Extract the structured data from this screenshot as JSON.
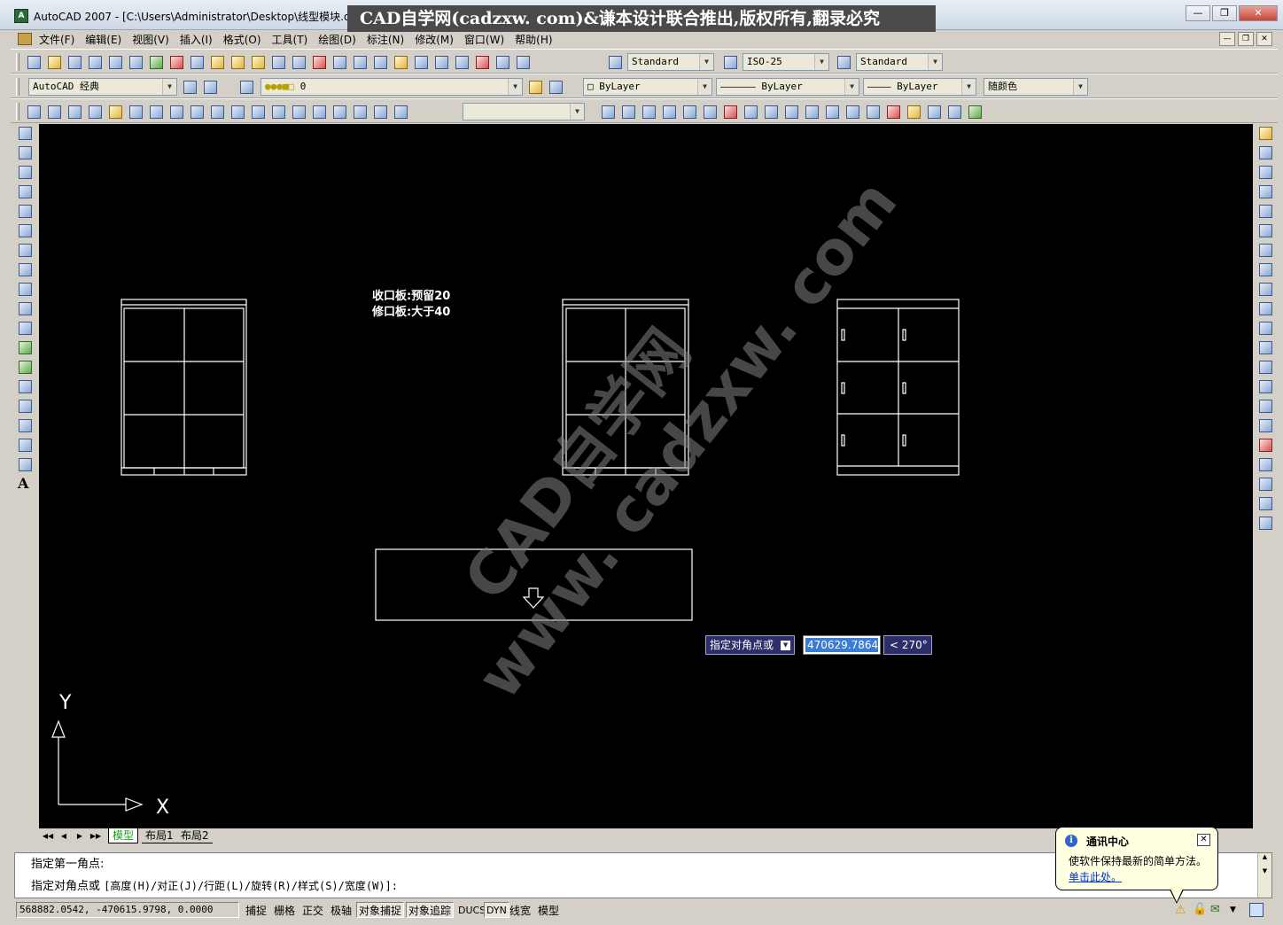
{
  "window": {
    "title": "AutoCAD 2007 - [C:\\Users\\Administrator\\Desktop\\线型模块.d",
    "watermark_banner": "CAD自学网(cadzxw. com)&谦本设计联合推出,版权所有,翻录必究"
  },
  "menu": {
    "items": [
      "文件(F)",
      "编辑(E)",
      "视图(V)",
      "插入(I)",
      "格式(O)",
      "工具(T)",
      "绘图(D)",
      "标注(N)",
      "修改(M)",
      "窗口(W)",
      "帮助(H)"
    ]
  },
  "styles": {
    "text_style": "Standard",
    "dim_style": "ISO-25",
    "table_style": "Standard"
  },
  "workspace": {
    "name": "AutoCAD 经典"
  },
  "layers": {
    "current": "0"
  },
  "properties": {
    "color": "ByLayer",
    "linetype": "ByLayer",
    "lineweight": "ByLayer",
    "plot_style": "随颜色"
  },
  "canvas": {
    "note_line1": "收口板:预留20",
    "note_line2": "修口板:大于40",
    "watermark_line1": "CAD自学网",
    "watermark_line2": "www. cadzxw. com",
    "ucs_x": "X",
    "ucs_y": "Y"
  },
  "dynamic_input": {
    "prompt": "指定对角点或",
    "value": "470629.7864",
    "angle": "< 270°"
  },
  "tabs": {
    "model": "模型",
    "layout1": "布局1",
    "layout2": "布局2"
  },
  "command": {
    "line1": "指定第一角点:",
    "line2_prefix": "指定对角点或",
    "line2_options": "[高度(H)/对正(J)/行距(L)/旋转(R)/样式(S)/宽度(W)]:"
  },
  "status": {
    "coords": "568882.0542, -470615.9798, 0.0000",
    "buttons": [
      "捕捉",
      "栅格",
      "正交",
      "极轴",
      "对象捕捉",
      "对象追踪",
      "DUCS",
      "DYN",
      "线宽",
      "模型"
    ]
  },
  "balloon": {
    "title": "通讯中心",
    "message": "使软件保持最新的简单方法。",
    "link": "单击此处。"
  },
  "colors": {
    "canvas_bg": "#000000",
    "ui_bg": "#d4d0c8",
    "dyn_bg": "#2d2d6a",
    "active_tab": "#1aa01a"
  }
}
